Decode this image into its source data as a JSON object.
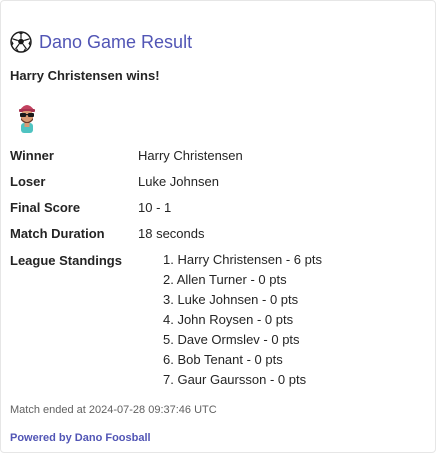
{
  "card": {
    "title": "Dano Game Result",
    "title_icon": "soccer-ball-icon",
    "headline": "Harry Christensen wins!",
    "avatar_icon": "winner-avatar-icon",
    "facts": [
      {
        "label": "Winner",
        "value": "Harry Christensen"
      },
      {
        "label": "Loser",
        "value": "Luke Johnsen"
      },
      {
        "label": "Final Score",
        "value": "10 - 1"
      },
      {
        "label": "Match Duration",
        "value": "18 seconds"
      }
    ],
    "standings_label": "League Standings",
    "standings": [
      "1. Harry Christensen - 6 pts",
      "2. Allen Turner - 0 pts",
      "3. Luke Johnsen - 0 pts",
      "4. John Roysen - 0 pts",
      "5. Dave Ormslev - 0 pts",
      "6. Bob Tenant - 0 pts",
      "7. Gaur Gaursson - 0 pts"
    ],
    "ended": "Match ended at 2024-07-28 09:37:46 UTC",
    "powered_by": "Powered by Dano Foosball"
  },
  "colors": {
    "accent": "#5155b5",
    "text": "#242424",
    "muted": "#616161"
  }
}
